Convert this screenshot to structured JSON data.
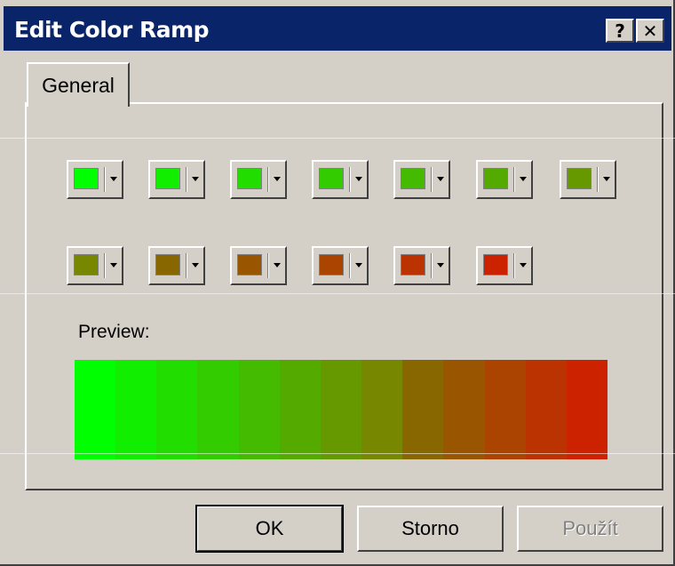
{
  "window": {
    "title": "Edit Color Ramp",
    "help_label": "?",
    "close_label": "✕"
  },
  "tabs": [
    {
      "label": "General"
    }
  ],
  "color_buttons_row1": [
    "#00ff00",
    "#12ee00",
    "#22dd00",
    "#33cc00",
    "#44bb00",
    "#55aa00",
    "#669900"
  ],
  "color_buttons_row2": [
    "#778800",
    "#886600",
    "#995500",
    "#aa4400",
    "#bb3300",
    "#cc2200"
  ],
  "preview": {
    "label": "Preview:",
    "colors": [
      "#00ff00",
      "#12ee00",
      "#22dd00",
      "#33cc00",
      "#44bb00",
      "#55aa00",
      "#669900",
      "#778800",
      "#886600",
      "#995500",
      "#aa4400",
      "#bb3300",
      "#cc2200"
    ]
  },
  "buttons": {
    "ok": "OK",
    "cancel": "Storno",
    "apply": "Použít"
  }
}
